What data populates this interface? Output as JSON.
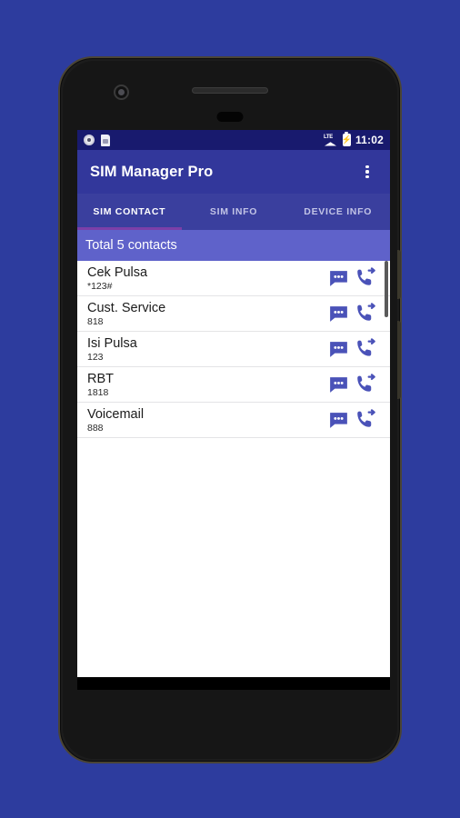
{
  "status_bar": {
    "time": "11:02",
    "icons_left": [
      "record-circle-icon",
      "sim-card-icon"
    ],
    "network_label": "LTE",
    "icons_right": [
      "lte-signal-icon",
      "battery-charging-icon"
    ]
  },
  "app_bar": {
    "title": "SIM Manager Pro",
    "overflow_menu": "overflow-menu-icon"
  },
  "tabs": [
    {
      "label": "SIM CONTACT",
      "active": true
    },
    {
      "label": "SIM INFO",
      "active": false
    },
    {
      "label": "DEVICE INFO",
      "active": false
    }
  ],
  "total_bar": {
    "text": "Total 5 contacts"
  },
  "contacts": [
    {
      "name": "Cek Pulsa",
      "number": "*123#"
    },
    {
      "name": "Cust. Service",
      "number": "818"
    },
    {
      "name": "Isi Pulsa",
      "number": "123"
    },
    {
      "name": "RBT",
      "number": "1818"
    },
    {
      "name": "Voicemail",
      "number": "888"
    }
  ],
  "row_actions": {
    "sms": "sms-message-icon",
    "call": "call-forward-icon"
  },
  "nav_bar": {
    "back": "back-triangle-icon",
    "home": "home-circle-icon",
    "recents": "recents-square-icon"
  },
  "colors": {
    "page_background": "#2d3c9e",
    "status_bar": "#181a6e",
    "app_bar": "#32379b",
    "tab_bar": "#3a3f9e",
    "tab_indicator": "#7b3fa8",
    "total_bar": "#5f62ca",
    "action_icon": "#4a52b8",
    "list_background": "#ffffff",
    "nav_bar": "#000000"
  }
}
